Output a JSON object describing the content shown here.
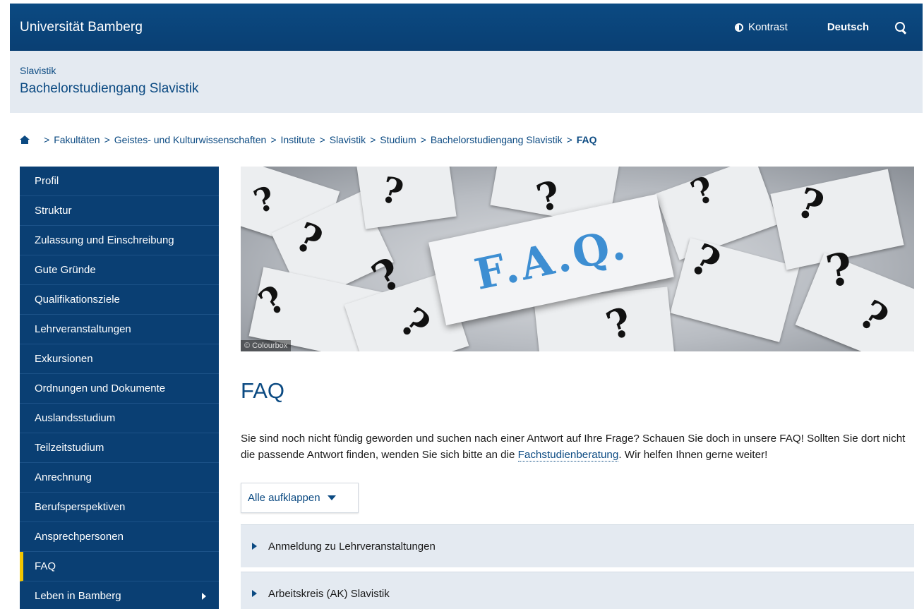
{
  "header": {
    "brand": "Universität Bamberg",
    "contrast_label": "Kontrast",
    "language_label": "Deutsch"
  },
  "subheader": {
    "parent": "Slavistik",
    "title": "Bachelorstudiengang Slavistik"
  },
  "breadcrumb": {
    "items": [
      "Fakultäten",
      "Geistes- und Kulturwissenschaften",
      "Institute",
      "Slavistik",
      "Studium",
      "Bachelorstudiengang Slavistik"
    ],
    "current": "FAQ",
    "separator": ">"
  },
  "sidebar": {
    "items": [
      {
        "label": "Profil"
      },
      {
        "label": "Struktur"
      },
      {
        "label": "Zulassung und Einschreibung"
      },
      {
        "label": "Gute Gründe"
      },
      {
        "label": "Qualifikationsziele"
      },
      {
        "label": "Lehrveranstaltungen"
      },
      {
        "label": "Exkursionen"
      },
      {
        "label": "Ordnungen und Dokumente"
      },
      {
        "label": "Auslandsstudium"
      },
      {
        "label": "Teilzeitstudium"
      },
      {
        "label": "Anrechnung"
      },
      {
        "label": "Berufsperspektiven"
      },
      {
        "label": "Ansprechpersonen"
      },
      {
        "label": "FAQ"
      },
      {
        "label": "Leben in Bamberg"
      }
    ],
    "active_item": "FAQ"
  },
  "hero": {
    "banner_text": "F.A.Q.",
    "credit": "© Colourbox"
  },
  "main": {
    "heading": "FAQ",
    "intro_before_link": "Sie sind noch nicht fündig geworden und suchen nach einer Antwort auf Ihre Frage? Schauen Sie doch in unsere FAQ! Sollten Sie dort nicht die passende Antwort finden, wenden Sie sich bitte an die ",
    "intro_link": "Fachstudienberatung",
    "intro_after_link": ". Wir helfen Ihnen gerne weiter!",
    "expand_all_label": "Alle aufklappen",
    "accordion": [
      {
        "label": "Anmeldung zu Lehrveranstaltungen"
      },
      {
        "label": "Arbeitskreis (AK) Slavistik"
      }
    ]
  },
  "colors": {
    "brand_blue": "#0a3f73",
    "light_band": "#e4eaf1",
    "active_marker": "#f2c500",
    "faq_text": "#3d8ed2"
  }
}
